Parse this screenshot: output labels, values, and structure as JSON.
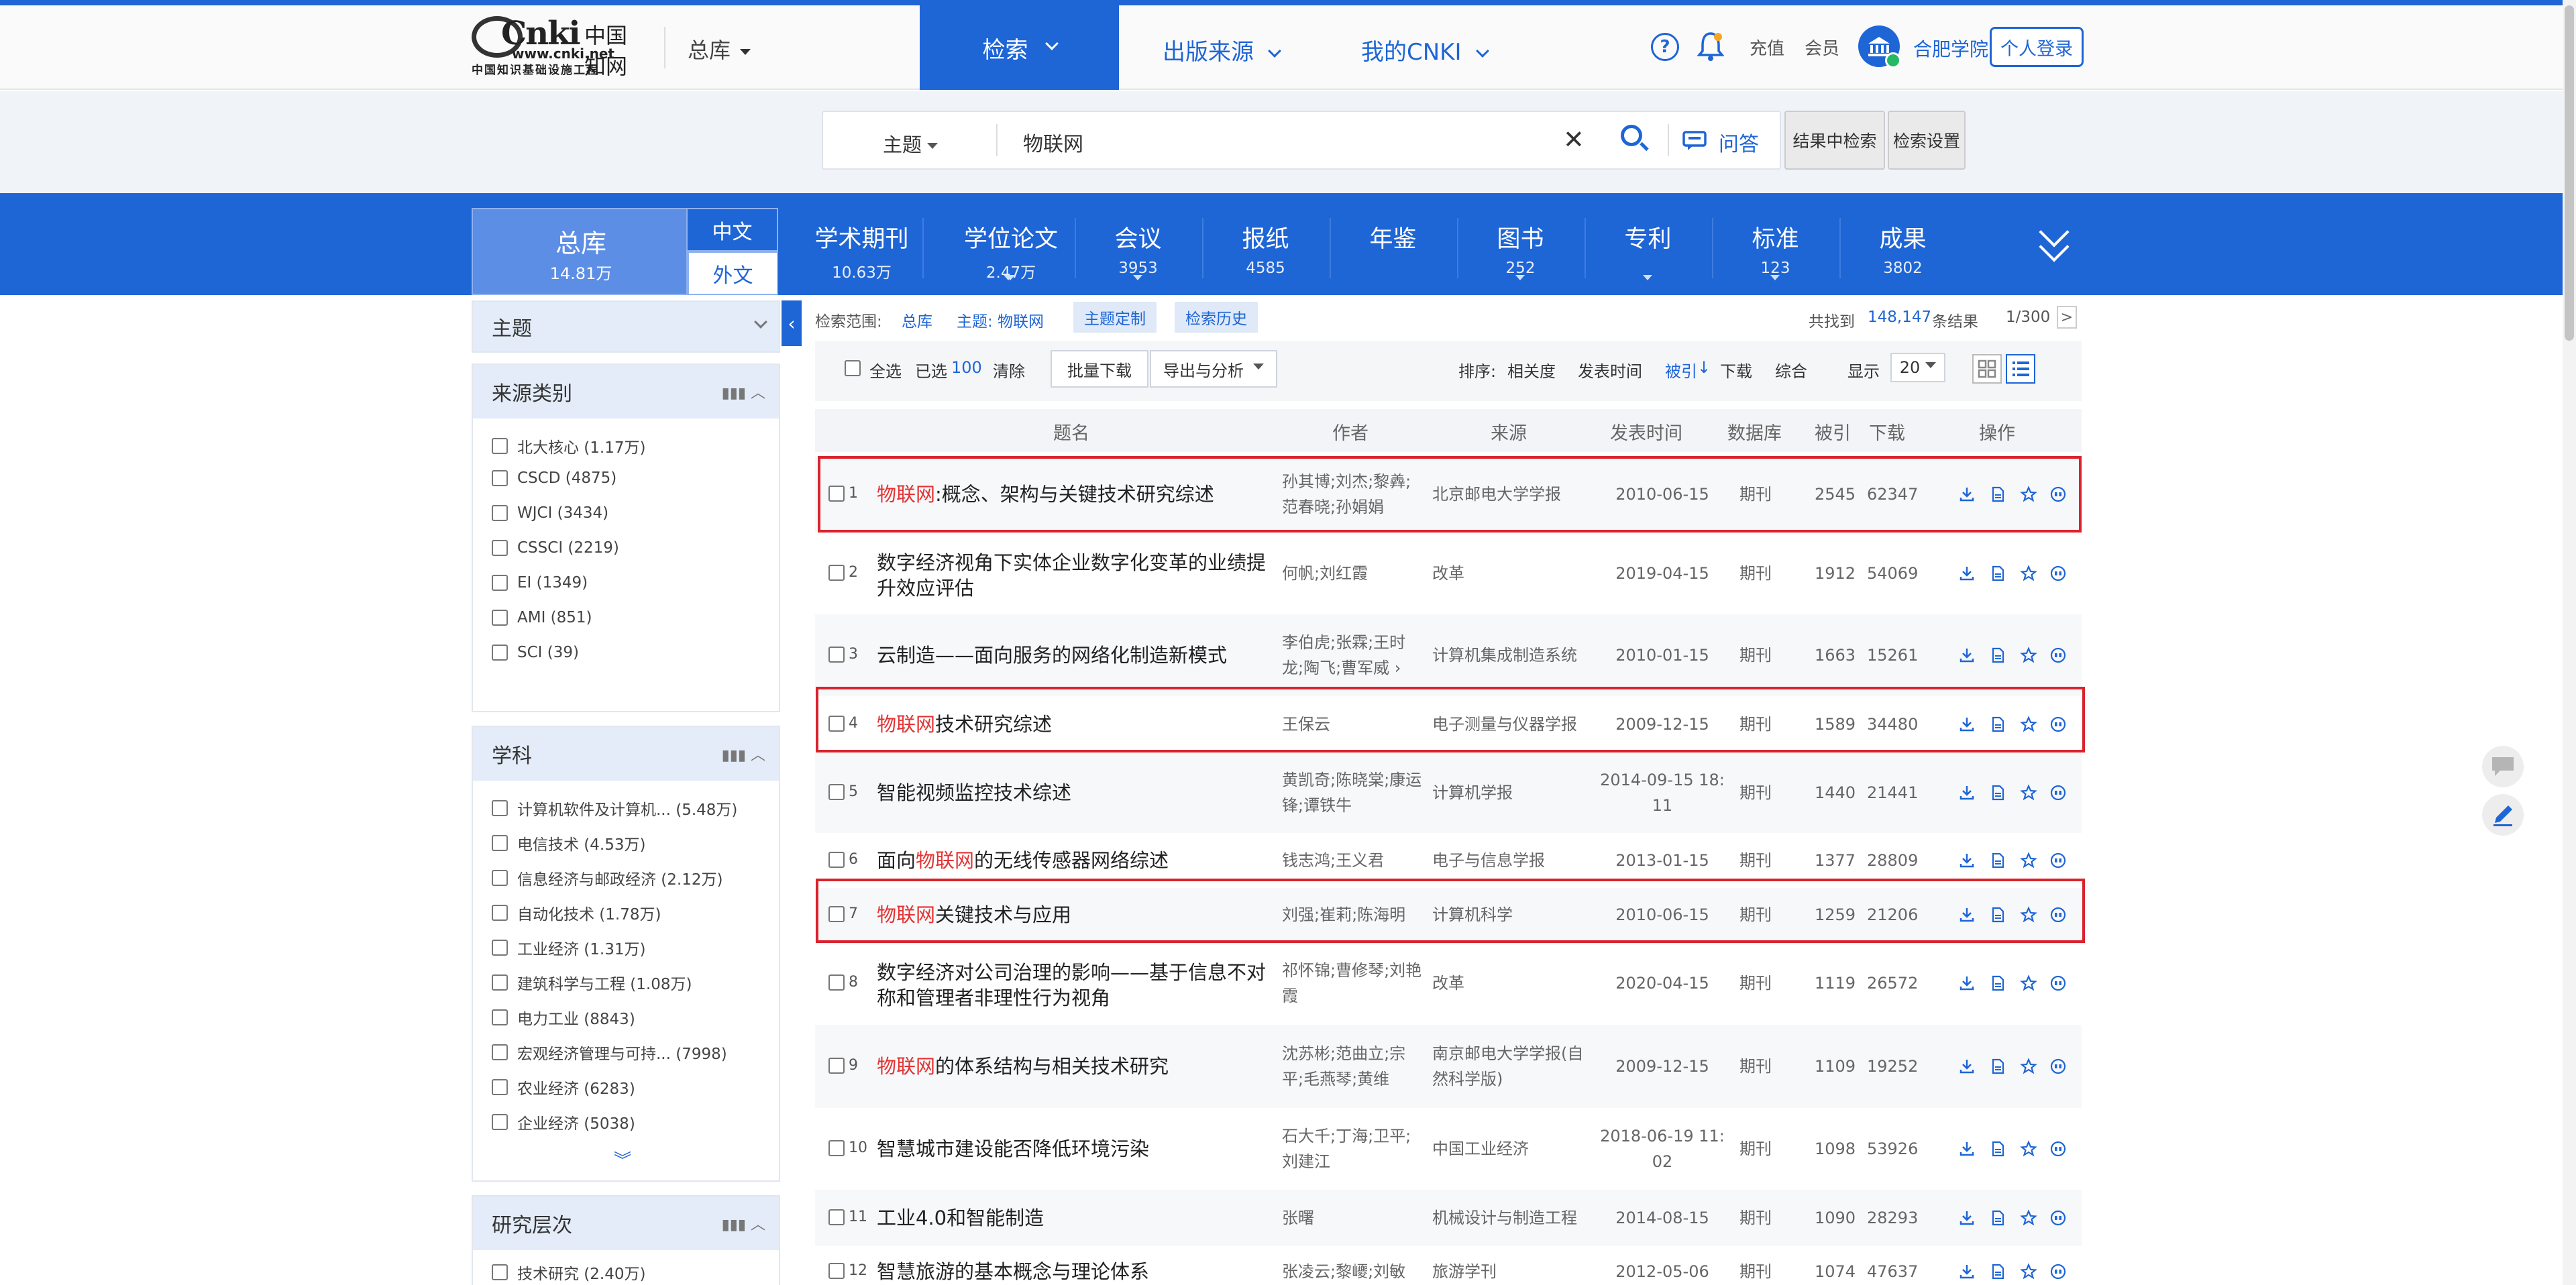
{
  "header": {
    "logo_main": "Cnki",
    "logo_cn": "中国知网",
    "logo_url": "www.cnki.net",
    "logo_sub": "中国知识基础设施工程",
    "db_selector": "总库",
    "nav": [
      {
        "label": "检索"
      },
      {
        "label": "出版来源"
      },
      {
        "label": "我的CNKI"
      }
    ],
    "help_glyph": "?",
    "links": {
      "recharge": "充值",
      "member": "会员"
    },
    "institution": "合肥学院",
    "login": "个人登录"
  },
  "search": {
    "field": "主题",
    "query": "物联网",
    "clear_glyph": "✕",
    "qa": "问答",
    "within_results": "结果中检索",
    "settings": "检索设置"
  },
  "db_tabs": {
    "all": {
      "label": "总库",
      "count": "14.81万"
    },
    "lang_cn": "中文",
    "lang_en": "外文",
    "tabs": [
      {
        "label": "学术期刊",
        "count": "10.63万"
      },
      {
        "label": "学位论文",
        "count": "2.47万"
      },
      {
        "label": "会议",
        "count": "3953"
      },
      {
        "label": "报纸",
        "count": "4585"
      },
      {
        "label": "年鉴",
        "count": ""
      },
      {
        "label": "图书",
        "count": "252"
      },
      {
        "label": "专利",
        "count": ""
      },
      {
        "label": "标准",
        "count": "123"
      },
      {
        "label": "成果",
        "count": "3802"
      }
    ]
  },
  "sidebar": {
    "topic": "主题",
    "source": {
      "title": "来源类别",
      "items": [
        "北大核心 (1.17万)",
        "CSCD (4875)",
        "WJCI (3434)",
        "CSSCI (2219)",
        "EI (1349)",
        "AMI (851)",
        "SCI (39)"
      ]
    },
    "subject": {
      "title": "学科",
      "items": [
        "计算机软件及计算机...  (5.48万)",
        "电信技术 (4.53万)",
        "信息经济与邮政经济 (2.12万)",
        "自动化技术 (1.78万)",
        "工业经济 (1.31万)",
        "建筑科学与工程 (1.08万)",
        "电力工业 (8843)",
        "宏观经济管理与可持...  (7998)",
        "农业经济 (6283)",
        "企业经济 (5038)"
      ]
    },
    "level": {
      "title": "研究层次",
      "items": [
        "技术研究 (2.40万)"
      ]
    }
  },
  "results_bar": {
    "scope_label": "检索范围:",
    "scope_db": "总库",
    "scope_topic": "主题:  物联网",
    "tag_custom": "主题定制",
    "tag_history": "检索历史",
    "found_prefix": "共找到",
    "found_count": "148,147",
    "found_suffix": "条结果",
    "page": "1/300",
    "next_glyph": ">"
  },
  "toolbar": {
    "select_all": "全选",
    "selected_label": "已选",
    "selected_count": "100",
    "clear": "清除",
    "batch_download": "批量下载",
    "export": "导出与分析",
    "sort_label": "排序:",
    "sort_options": [
      "相关度",
      "发表时间",
      "被引",
      "下载",
      "综合"
    ],
    "sort_active": "被引",
    "sort_arrow": "↓",
    "display_label": "显示",
    "display_value": "20"
  },
  "table": {
    "headers": [
      "题名",
      "作者",
      "来源",
      "发表时间",
      "数据库",
      "被引",
      "下载",
      "操作"
    ],
    "rows": [
      {
        "n": "1",
        "hl": "物联网",
        "title": ":概念、架构与关键技术研究综述",
        "title2": "",
        "author": "孙其博;刘杰;黎羴;",
        "author2": "范春晓;孙娟娟",
        "source": "北京邮电大学学报",
        "source2": "",
        "date": "2010-06-15",
        "date2": "",
        "db": "期刊",
        "cited": "2545",
        "dl": "62347"
      },
      {
        "n": "2",
        "hl": "",
        "title": "数字经济视角下实体企业数字化变革的业绩提",
        "title2": "升效应评估",
        "author": "何帆;刘红霞",
        "author2": "",
        "source": "改革",
        "source2": "",
        "date": "2019-04-15",
        "date2": "",
        "db": "期刊",
        "cited": "1912",
        "dl": "54069"
      },
      {
        "n": "3",
        "hl": "",
        "title": "云制造——面向服务的网络化制造新模式",
        "title2": "",
        "author": "李伯虎;张霖;王时",
        "author2": "龙;陶飞;曹军威 ›",
        "source": "计算机集成制造系统",
        "source2": "",
        "date": "2010-01-15",
        "date2": "",
        "db": "期刊",
        "cited": "1663",
        "dl": "15261"
      },
      {
        "n": "4",
        "hl": "物联网",
        "title": "技术研究综述",
        "title2": "",
        "author": "王保云",
        "author2": "",
        "source": "电子测量与仪器学报",
        "source2": "",
        "date": "2009-12-15",
        "date2": "",
        "db": "期刊",
        "cited": "1589",
        "dl": "34480"
      },
      {
        "n": "5",
        "hl": "",
        "title": "智能视频监控技术综述",
        "title2": "",
        "author": "黄凯奇;陈晓棠;康运",
        "author2": "锋;谭铁牛",
        "source": "计算机学报",
        "source2": "",
        "date": "2014-09-15 18:",
        "date2": "11",
        "db": "期刊",
        "cited": "1440",
        "dl": "21441"
      },
      {
        "n": "6",
        "hl": "",
        "title": "面向",
        "title_hl_mid": "物联网",
        "title_tail": "的无线传感器网络综述",
        "title2": "",
        "author": "钱志鸿;王义君",
        "author2": "",
        "source": "电子与信息学报",
        "source2": "",
        "date": "2013-01-15",
        "date2": "",
        "db": "期刊",
        "cited": "1377",
        "dl": "28809"
      },
      {
        "n": "7",
        "hl": "物联网",
        "title": "关键技术与应用",
        "title2": "",
        "author": "刘强;崔莉;陈海明",
        "author2": "",
        "source": "计算机科学",
        "source2": "",
        "date": "2010-06-15",
        "date2": "",
        "db": "期刊",
        "cited": "1259",
        "dl": "21206"
      },
      {
        "n": "8",
        "hl": "",
        "title": "数字经济对公司治理的影响——基于信息不对",
        "title2": "称和管理者非理性行为视角",
        "author": "祁怀锦;曹修琴;刘艳",
        "author2": "霞",
        "source": "改革",
        "source2": "",
        "date": "2020-04-15",
        "date2": "",
        "db": "期刊",
        "cited": "1119",
        "dl": "26572"
      },
      {
        "n": "9",
        "hl": "物联网",
        "title": "的体系结构与相关技术研究",
        "title2": "",
        "author": "沈苏彬;范曲立;宗",
        "author2": "平;毛燕琴;黄维",
        "source": "南京邮电大学学报(自",
        "source2": "然科学版)",
        "date": "2009-12-15",
        "date2": "",
        "db": "期刊",
        "cited": "1109",
        "dl": "19252"
      },
      {
        "n": "10",
        "hl": "",
        "title": "智慧城市建设能否降低环境污染",
        "title2": "",
        "author": "石大千;丁海;卫平;",
        "author2": "刘建江",
        "source": "中国工业经济",
        "source2": "",
        "date": "2018-06-19 11:",
        "date2": "02",
        "db": "期刊",
        "cited": "1098",
        "dl": "53926"
      },
      {
        "n": "11",
        "hl": "",
        "title": "工业4.0和智能制造",
        "title2": "",
        "author": "张曙",
        "author2": "",
        "source": "机械设计与制造工程",
        "source2": "",
        "date": "2014-08-15",
        "date2": "",
        "db": "期刊",
        "cited": "1090",
        "dl": "28293"
      },
      {
        "n": "12",
        "hl": "",
        "title": "智慧旅游的基本概念与理论体系",
        "title2": "",
        "author": "张凌云;黎巎;刘敏",
        "author2": "",
        "source": "旅游学刊",
        "source2": "",
        "date": "2012-05-06",
        "date2": "",
        "db": "期刊",
        "cited": "1074",
        "dl": "47637"
      }
    ]
  },
  "icons": {
    "download": "download-icon",
    "read": "read-icon",
    "favorite": "star-icon",
    "cite": "quote-icon"
  },
  "colors": {
    "brand": "#1e65d6",
    "highlight": "#e53333",
    "annotation": "#d9232d"
  }
}
